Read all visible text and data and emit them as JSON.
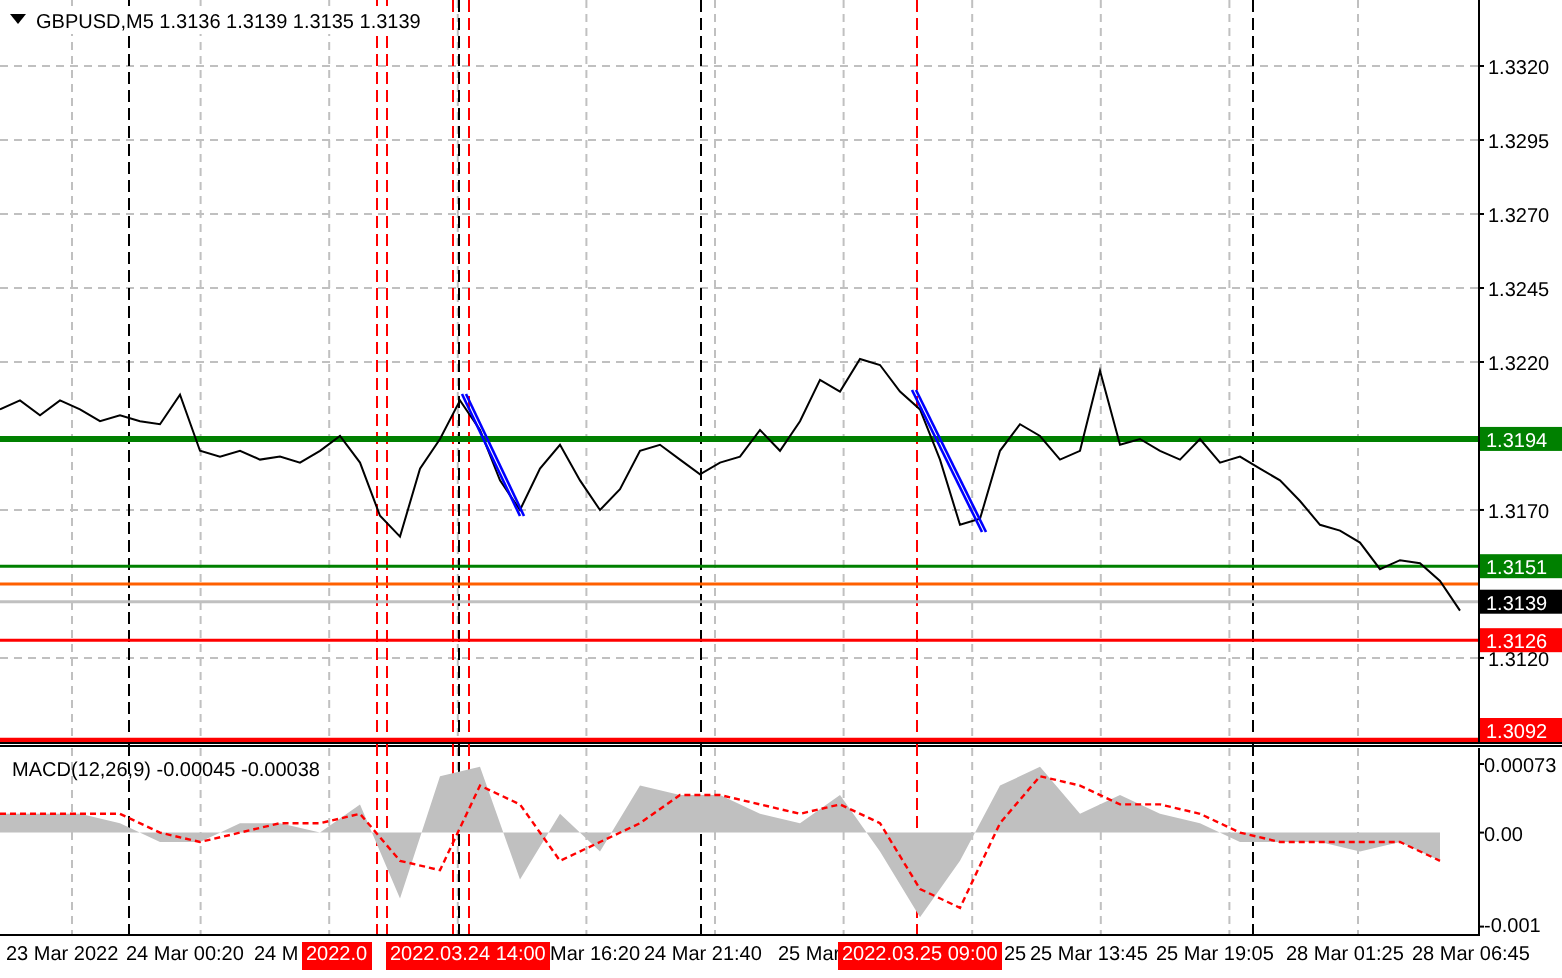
{
  "header": {
    "text": "GBPUSD,M5  1.3136 1.3139 1.3135 1.3139"
  },
  "price_chart": {
    "chart_data": {
      "type": "line",
      "grid": true,
      "ylim": [
        1.30916,
        1.33423
      ],
      "series": [
        {
          "color": "#000000",
          "values": [
            1.3204,
            1.3207,
            1.3202,
            1.3207,
            1.3204,
            1.32,
            1.3202,
            1.32,
            1.3199,
            1.3209,
            1.319,
            1.3188,
            1.319,
            1.3187,
            1.3188,
            1.3186,
            1.319,
            1.3195,
            1.3186,
            1.3168,
            1.3161,
            1.3184,
            1.3194,
            1.3207,
            1.3197,
            1.318,
            1.317,
            1.3184,
            1.3192,
            1.318,
            1.317,
            1.3177,
            1.319,
            1.3192,
            1.3187,
            1.3182,
            1.3186,
            1.3188,
            1.3197,
            1.319,
            1.32,
            1.3214,
            1.321,
            1.3221,
            1.3219,
            1.321,
            1.3204,
            1.3187,
            1.3165,
            1.3167,
            1.319,
            1.3199,
            1.3195,
            1.3187,
            1.319,
            1.3217,
            1.3192,
            1.3194,
            1.319,
            1.3187,
            1.3194,
            1.3186,
            1.3188,
            1.3184,
            1.318,
            1.3173,
            1.3165,
            1.3163,
            1.3159,
            1.315,
            1.3153,
            1.3152,
            1.3146,
            1.3136
          ]
        }
      ],
      "yticks": [
        {
          "value": 1.332,
          "label": "1.3320"
        },
        {
          "value": 1.3295,
          "label": "1.3295"
        },
        {
          "value": 1.327,
          "label": "1.3270"
        },
        {
          "value": 1.3245,
          "label": "1.3245"
        },
        {
          "value": 1.322,
          "label": "1.3220"
        },
        {
          "value": 1.317,
          "label": "1.3170"
        },
        {
          "value": 1.312,
          "label": "1.3120"
        }
      ],
      "ref_lines": [
        {
          "axis": "y",
          "value": 1.3194,
          "color": "#008000",
          "label": "1.3194"
        },
        {
          "axis": "y",
          "value": 1.3151,
          "color": "#008000",
          "label": "1.3151"
        },
        {
          "axis": "y",
          "value": 1.3145,
          "color": "#ff6000"
        },
        {
          "axis": "y",
          "value": 1.3139,
          "color": "#c0c0c0",
          "label": "1.3139"
        },
        {
          "axis": "y",
          "value": 1.3126,
          "color": "#ff0000",
          "label": "1.3126"
        },
        {
          "axis": "y",
          "value": 1.3092,
          "color": "#ff0000",
          "label": "1.3092"
        }
      ]
    }
  },
  "macd_chart": {
    "chart_data": {
      "type": "area",
      "grid": true,
      "title": "MACD(12,26,9) -0.00045 -0.00038",
      "ylim": [
        -0.0011,
        0.0009
      ],
      "series": [
        {
          "color": "#c0c0c0",
          "values": [
            0.0002,
            0.0002,
            0.0002,
            0.0001,
            -0.0001,
            -0.0001,
            0.0001,
            0.0001,
            0.0,
            0.0003,
            -0.0007,
            0.0006,
            0.0007,
            -0.0005,
            0.0002,
            -0.0002,
            0.0005,
            0.0004,
            0.0004,
            0.0002,
            0.0001,
            0.0004,
            -0.0002,
            -0.0009,
            -0.0003,
            0.0005,
            0.0007,
            0.0002,
            0.0004,
            0.0002,
            0.0001,
            -0.0001,
            -0.0001,
            -0.0001,
            -0.0002,
            -0.0001,
            -0.0003
          ]
        },
        {
          "type": "line",
          "line_style": "dashed",
          "color": "#ff0000",
          "values": [
            0.0002,
            0.0002,
            0.0002,
            0.0002,
            0.0,
            -0.0001,
            0.0,
            0.0001,
            0.0001,
            0.0002,
            -0.0003,
            -0.0004,
            0.0005,
            0.0003,
            -0.0003,
            -0.0001,
            0.0001,
            0.0004,
            0.0004,
            0.0003,
            0.0002,
            0.0003,
            0.0001,
            -0.0006,
            -0.0008,
            0.0001,
            0.0006,
            0.0005,
            0.0003,
            0.0003,
            0.0002,
            0.0,
            -0.0001,
            -0.0001,
            -0.0001,
            -0.0001,
            -0.0003
          ]
        }
      ],
      "yticks": [
        {
          "value": 0.00073,
          "label": "0.00073"
        },
        {
          "value": 0,
          "label": "0.00"
        },
        {
          "value": -0.001,
          "label": "-0.001"
        }
      ]
    }
  },
  "time_axis": [
    {
      "label": "23 Mar 2022",
      "kind": "tick"
    },
    {
      "label": "24 Mar 00:20",
      "kind": "tick"
    },
    {
      "label": "24 M",
      "kind": "tick"
    },
    {
      "label": "2022.0",
      "kind": "marker"
    },
    {
      "label": "2022.03.24 14:00",
      "kind": "marker"
    },
    {
      "label": "Mar 16:20",
      "kind": "tick"
    },
    {
      "label": "24 Mar 21:40",
      "kind": "tick"
    },
    {
      "label": "25 Mar",
      "kind": "tick"
    },
    {
      "label": "2022.03.25 09:00",
      "kind": "marker"
    },
    {
      "label": "25",
      "kind": "tick"
    },
    {
      "label": "25 Mar 13:45",
      "kind": "tick"
    },
    {
      "label": "25 Mar 19:05",
      "kind": "tick"
    },
    {
      "label": "28 Mar 01:25",
      "kind": "tick"
    },
    {
      "label": "28 Mar 06:45",
      "kind": "tick"
    }
  ]
}
